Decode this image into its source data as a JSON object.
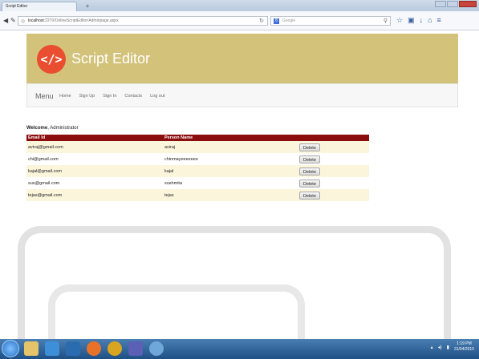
{
  "browser": {
    "tab_title": "Script Editor",
    "new_tab": "+",
    "url_host": "localhost",
    "url_path": ":2270/OnlineScriptEditor/Adminpage.aspx",
    "search_engine_letter": "8",
    "search_placeholder": "Google"
  },
  "header": {
    "logo_symbol": "</>",
    "brand": "Script Editor",
    "brand_color": "#d2c27a",
    "logo_color": "#e94e30"
  },
  "menu": {
    "title": "Menu",
    "links": [
      "Home",
      "Sign Up",
      "Sign In",
      "Contacts",
      "Log out"
    ]
  },
  "welcome": {
    "label": "Welcome",
    "name": ", Administrator"
  },
  "table": {
    "header_color": "#8b0d0d",
    "columns": [
      "Email Id",
      "Person Name"
    ],
    "delete_label": "Delete",
    "rows": [
      {
        "email": "aviraj@gmail.com",
        "name": "aviraj"
      },
      {
        "email": "chi@gmail.com",
        "name": "chinmayeeeeeee"
      },
      {
        "email": "kajal@gmail.com",
        "name": "kajal"
      },
      {
        "email": "sus@gmail.com",
        "name": "sushmita"
      },
      {
        "email": "tejas@gmail.com",
        "name": "tejas"
      }
    ]
  },
  "taskbar": {
    "time": "1:19 PM",
    "date": "31/04/2015"
  }
}
